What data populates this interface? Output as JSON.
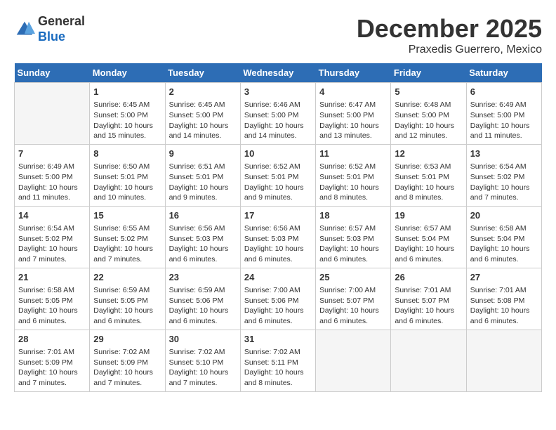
{
  "header": {
    "logo_general": "General",
    "logo_blue": "Blue",
    "title": "December 2025",
    "location": "Praxedis Guerrero, Mexico"
  },
  "days_of_week": [
    "Sunday",
    "Monday",
    "Tuesday",
    "Wednesday",
    "Thursday",
    "Friday",
    "Saturday"
  ],
  "weeks": [
    [
      {
        "day": "",
        "content": ""
      },
      {
        "day": "1",
        "content": "Sunrise: 6:45 AM\nSunset: 5:00 PM\nDaylight: 10 hours\nand 15 minutes."
      },
      {
        "day": "2",
        "content": "Sunrise: 6:45 AM\nSunset: 5:00 PM\nDaylight: 10 hours\nand 14 minutes."
      },
      {
        "day": "3",
        "content": "Sunrise: 6:46 AM\nSunset: 5:00 PM\nDaylight: 10 hours\nand 14 minutes."
      },
      {
        "day": "4",
        "content": "Sunrise: 6:47 AM\nSunset: 5:00 PM\nDaylight: 10 hours\nand 13 minutes."
      },
      {
        "day": "5",
        "content": "Sunrise: 6:48 AM\nSunset: 5:00 PM\nDaylight: 10 hours\nand 12 minutes."
      },
      {
        "day": "6",
        "content": "Sunrise: 6:49 AM\nSunset: 5:00 PM\nDaylight: 10 hours\nand 11 minutes."
      }
    ],
    [
      {
        "day": "7",
        "content": "Sunrise: 6:49 AM\nSunset: 5:00 PM\nDaylight: 10 hours\nand 11 minutes."
      },
      {
        "day": "8",
        "content": "Sunrise: 6:50 AM\nSunset: 5:01 PM\nDaylight: 10 hours\nand 10 minutes."
      },
      {
        "day": "9",
        "content": "Sunrise: 6:51 AM\nSunset: 5:01 PM\nDaylight: 10 hours\nand 9 minutes."
      },
      {
        "day": "10",
        "content": "Sunrise: 6:52 AM\nSunset: 5:01 PM\nDaylight: 10 hours\nand 9 minutes."
      },
      {
        "day": "11",
        "content": "Sunrise: 6:52 AM\nSunset: 5:01 PM\nDaylight: 10 hours\nand 8 minutes."
      },
      {
        "day": "12",
        "content": "Sunrise: 6:53 AM\nSunset: 5:01 PM\nDaylight: 10 hours\nand 8 minutes."
      },
      {
        "day": "13",
        "content": "Sunrise: 6:54 AM\nSunset: 5:02 PM\nDaylight: 10 hours\nand 7 minutes."
      }
    ],
    [
      {
        "day": "14",
        "content": "Sunrise: 6:54 AM\nSunset: 5:02 PM\nDaylight: 10 hours\nand 7 minutes."
      },
      {
        "day": "15",
        "content": "Sunrise: 6:55 AM\nSunset: 5:02 PM\nDaylight: 10 hours\nand 7 minutes."
      },
      {
        "day": "16",
        "content": "Sunrise: 6:56 AM\nSunset: 5:03 PM\nDaylight: 10 hours\nand 6 minutes."
      },
      {
        "day": "17",
        "content": "Sunrise: 6:56 AM\nSunset: 5:03 PM\nDaylight: 10 hours\nand 6 minutes."
      },
      {
        "day": "18",
        "content": "Sunrise: 6:57 AM\nSunset: 5:03 PM\nDaylight: 10 hours\nand 6 minutes."
      },
      {
        "day": "19",
        "content": "Sunrise: 6:57 AM\nSunset: 5:04 PM\nDaylight: 10 hours\nand 6 minutes."
      },
      {
        "day": "20",
        "content": "Sunrise: 6:58 AM\nSunset: 5:04 PM\nDaylight: 10 hours\nand 6 minutes."
      }
    ],
    [
      {
        "day": "21",
        "content": "Sunrise: 6:58 AM\nSunset: 5:05 PM\nDaylight: 10 hours\nand 6 minutes."
      },
      {
        "day": "22",
        "content": "Sunrise: 6:59 AM\nSunset: 5:05 PM\nDaylight: 10 hours\nand 6 minutes."
      },
      {
        "day": "23",
        "content": "Sunrise: 6:59 AM\nSunset: 5:06 PM\nDaylight: 10 hours\nand 6 minutes."
      },
      {
        "day": "24",
        "content": "Sunrise: 7:00 AM\nSunset: 5:06 PM\nDaylight: 10 hours\nand 6 minutes."
      },
      {
        "day": "25",
        "content": "Sunrise: 7:00 AM\nSunset: 5:07 PM\nDaylight: 10 hours\nand 6 minutes."
      },
      {
        "day": "26",
        "content": "Sunrise: 7:01 AM\nSunset: 5:07 PM\nDaylight: 10 hours\nand 6 minutes."
      },
      {
        "day": "27",
        "content": "Sunrise: 7:01 AM\nSunset: 5:08 PM\nDaylight: 10 hours\nand 6 minutes."
      }
    ],
    [
      {
        "day": "28",
        "content": "Sunrise: 7:01 AM\nSunset: 5:09 PM\nDaylight: 10 hours\nand 7 minutes."
      },
      {
        "day": "29",
        "content": "Sunrise: 7:02 AM\nSunset: 5:09 PM\nDaylight: 10 hours\nand 7 minutes."
      },
      {
        "day": "30",
        "content": "Sunrise: 7:02 AM\nSunset: 5:10 PM\nDaylight: 10 hours\nand 7 minutes."
      },
      {
        "day": "31",
        "content": "Sunrise: 7:02 AM\nSunset: 5:11 PM\nDaylight: 10 hours\nand 8 minutes."
      },
      {
        "day": "",
        "content": ""
      },
      {
        "day": "",
        "content": ""
      },
      {
        "day": "",
        "content": ""
      }
    ]
  ]
}
